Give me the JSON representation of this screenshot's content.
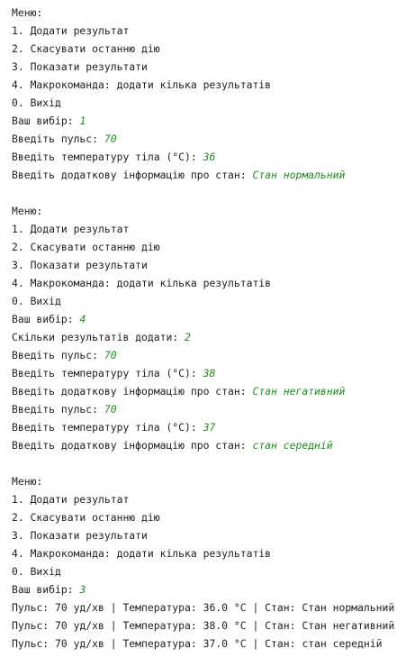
{
  "colors": {
    "background": "#ffffff",
    "output_text": "#1e1e1e",
    "user_input": "#228b22"
  },
  "console": {
    "lines": [
      {
        "text": "Меню:"
      },
      {
        "text": "1. Додати результат"
      },
      {
        "text": "2. Скасувати останню дію"
      },
      {
        "text": "3. Показати результати"
      },
      {
        "text": "4. Макрокоманда: додати кілька результатів"
      },
      {
        "text": "0. Вихід"
      },
      {
        "prompt": "Ваш вибір: ",
        "input": "1"
      },
      {
        "prompt": "Введіть пульс: ",
        "input": "70"
      },
      {
        "prompt": "Введіть температуру тіла (°C): ",
        "input": "36"
      },
      {
        "prompt": "Введіть додаткову інформацію про стан: ",
        "input": "Стан нормальний"
      },
      {
        "blank": true
      },
      {
        "text": "Меню:"
      },
      {
        "text": "1. Додати результат"
      },
      {
        "text": "2. Скасувати останню дію"
      },
      {
        "text": "3. Показати результати"
      },
      {
        "text": "4. Макрокоманда: додати кілька результатів"
      },
      {
        "text": "0. Вихід"
      },
      {
        "prompt": "Ваш вибір: ",
        "input": "4"
      },
      {
        "prompt": "Скільки результатів додати: ",
        "input": "2"
      },
      {
        "prompt": "Введіть пульс: ",
        "input": "70"
      },
      {
        "prompt": "Введіть температуру тіла (°C): ",
        "input": "38"
      },
      {
        "prompt": "Введіть додаткову інформацію про стан: ",
        "input": "Стан негативний"
      },
      {
        "prompt": "Введіть пульс: ",
        "input": "70"
      },
      {
        "prompt": "Введіть температуру тіла (°C): ",
        "input": "37"
      },
      {
        "prompt": "Введіть додаткову інформацію про стан: ",
        "input": "стан середній"
      },
      {
        "blank": true
      },
      {
        "text": "Меню:"
      },
      {
        "text": "1. Додати результат"
      },
      {
        "text": "2. Скасувати останню дію"
      },
      {
        "text": "3. Показати результати"
      },
      {
        "text": "4. Макрокоманда: додати кілька результатів"
      },
      {
        "text": "0. Вихід"
      },
      {
        "prompt": "Ваш вибір: ",
        "input": "3"
      },
      {
        "text": "Пульс: 70 уд/хв | Температура: 36.0 °C | Стан: Стан нормальний"
      },
      {
        "text": "Пульс: 70 уд/хв | Температура: 38.0 °C | Стан: Стан негативний"
      },
      {
        "text": "Пульс: 70 уд/хв | Температура: 37.0 °C | Стан: стан середній"
      }
    ]
  }
}
